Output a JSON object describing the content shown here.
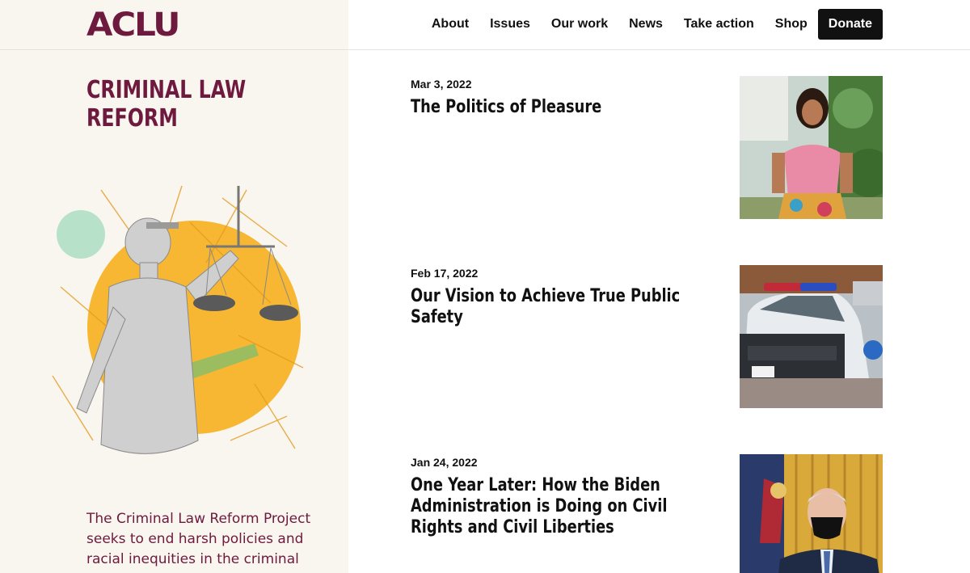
{
  "header": {
    "logo": "ACLU",
    "nav": [
      "About",
      "Issues",
      "Our work",
      "News",
      "Take action",
      "Shop"
    ],
    "donate_label": "Donate"
  },
  "sidebar": {
    "title": "CRIMINAL LAW REFORM",
    "description": "The Criminal Law Reform Project seeks to end harsh policies and racial inequities in the criminal"
  },
  "articles": [
    {
      "date": "Mar 3, 2022",
      "title": "The Politics of Pleasure"
    },
    {
      "date": "Feb 17, 2022",
      "title": "Our Vision to Achieve True Public Safety"
    },
    {
      "date": "Jan 24, 2022",
      "title": "One Year Later: How the Biden Administration is Doing on Civil Rights and Civil Liberties"
    }
  ],
  "colors": {
    "brand": "#6d1a3e",
    "panel": "#f9f5ef",
    "button": "#111111"
  }
}
